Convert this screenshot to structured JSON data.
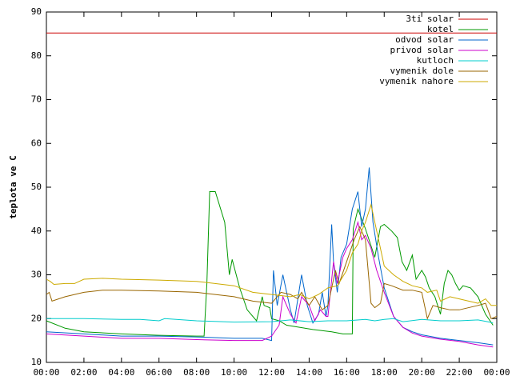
{
  "chart_data": {
    "type": "line",
    "title": "",
    "xlabel": "",
    "ylabel": "teplota ve C",
    "xlim": [
      "00:00",
      "24:00"
    ],
    "ylim": [
      10,
      90
    ],
    "grid": false,
    "legend_position": "top-right",
    "x_ticks": [
      "00:00",
      "02:00",
      "04:00",
      "06:00",
      "08:00",
      "10:00",
      "12:00",
      "14:00",
      "16:00",
      "18:00",
      "20:00",
      "22:00",
      "00:00"
    ],
    "y_ticks": [
      10,
      20,
      30,
      40,
      50,
      60,
      70,
      80,
      90
    ],
    "series": [
      {
        "name": "3ti solar",
        "color": "#cc0000",
        "x": [
          0,
          24
        ],
        "y": [
          85.2,
          85.2
        ]
      },
      {
        "name": "kotel",
        "color": "#009900",
        "x": [
          0,
          1,
          2,
          4,
          6,
          8,
          8.4,
          8.55,
          8.7,
          9,
          9.5,
          9.75,
          9.9,
          10.3,
          10.7,
          11.2,
          11.5,
          11.6,
          11.9,
          12.0,
          12.4,
          12.8,
          14.2,
          15.2,
          15.8,
          16.3,
          16.35,
          16.6,
          17.0,
          17.5,
          17.8,
          18.0,
          18.4,
          18.7,
          18.95,
          19.2,
          19.5,
          19.7,
          20.0,
          20.2,
          20.4,
          20.7,
          21.0,
          21.2,
          21.4,
          21.6,
          21.8,
          22.0,
          22.2,
          22.6,
          23.0,
          23.4,
          23.8
        ],
        "y": [
          19.5,
          17.8,
          17,
          16.5,
          16.2,
          16,
          16,
          28,
          49,
          49,
          42,
          30,
          33.5,
          27,
          22,
          19.5,
          25,
          23,
          22.5,
          20,
          19.5,
          18.5,
          17.5,
          17,
          16.5,
          16.5,
          40.5,
          45,
          40.5,
          34,
          41,
          41.5,
          40,
          38.5,
          33,
          31,
          34.5,
          29,
          31,
          29.5,
          27,
          25,
          21,
          28,
          31,
          30,
          28,
          26.5,
          27.5,
          27,
          25,
          21,
          18.5
        ]
      },
      {
        "name": "odvod solar",
        "color": "#0066cc",
        "x": [
          0,
          2,
          4,
          6,
          8,
          10,
          11.5,
          12.0,
          12.1,
          12.3,
          12.6,
          13.0,
          13.2,
          13.6,
          13.9,
          14.2,
          14.5,
          14.7,
          14.9,
          15.0,
          15.2,
          15.3,
          15.5,
          15.7,
          16.0,
          16.3,
          16.6,
          16.8,
          17.0,
          17.2,
          17.4,
          17.7,
          18.0,
          18.5,
          19.0,
          19.5,
          20,
          21,
          22,
          23,
          23.8
        ],
        "y": [
          17,
          16.5,
          16,
          16,
          15.8,
          15.5,
          15.5,
          15,
          31,
          23,
          30,
          22,
          19,
          30,
          23,
          19,
          21,
          26,
          20.5,
          23,
          41.5,
          33,
          26,
          34,
          37,
          45,
          49,
          41,
          45,
          54.5,
          42,
          34,
          27,
          20.5,
          18,
          17,
          16.3,
          15.5,
          15,
          14.5,
          14
        ]
      },
      {
        "name": "privod solar",
        "color": "#cc00cc",
        "x": [
          0,
          2,
          4,
          6,
          8,
          10,
          11.5,
          12.0,
          12.4,
          12.6,
          13.0,
          13.3,
          13.6,
          14.0,
          14.3,
          14.6,
          14.9,
          15.0,
          15.3,
          15.5,
          15.8,
          16.0,
          16.3,
          16.6,
          16.8,
          17.0,
          17.3,
          17.6,
          18.0,
          18.5,
          19.0,
          19.5,
          20,
          21,
          22,
          23,
          23.8
        ],
        "y": [
          16.5,
          16,
          15.5,
          15.5,
          15.2,
          15,
          15,
          16,
          18.5,
          25,
          21,
          19,
          25,
          23,
          19.5,
          22,
          20.5,
          20.5,
          33,
          28,
          34,
          36,
          38,
          42,
          38,
          39,
          36,
          31,
          26,
          20.5,
          18,
          16.7,
          16,
          15.3,
          14.8,
          14,
          13.5
        ]
      },
      {
        "name": "kutloch",
        "color": "#00cccc",
        "x": [
          0,
          2,
          4,
          5,
          6,
          6.3,
          8,
          10,
          12,
          13,
          14,
          15,
          16,
          17,
          17.5,
          18,
          18.5,
          19,
          20,
          21,
          22,
          23,
          23.5,
          23.8
        ],
        "y": [
          20,
          20,
          19.8,
          19.8,
          19.5,
          20,
          19.5,
          19.2,
          19.3,
          19.7,
          19.3,
          19.5,
          19.5,
          19.8,
          19.5,
          19.8,
          20,
          19.3,
          19.8,
          19.5,
          19.5,
          19.7,
          19.3,
          19
        ]
      },
      {
        "name": "vymenik dole",
        "color": "#996600",
        "x": [
          0,
          0.15,
          0.3,
          1,
          2,
          3,
          4,
          6,
          8,
          10,
          11,
          12,
          12.5,
          13,
          13.4,
          13.6,
          14.0,
          14.3,
          14.7,
          15.0,
          15.4,
          15.6,
          16.0,
          16.4,
          16.7,
          17.0,
          17.3,
          17.5,
          17.8,
          18.0,
          18.4,
          19.0,
          19.5,
          20.0,
          20.3,
          20.6,
          21.0,
          21.5,
          22,
          23,
          23.4,
          23.7,
          24
        ],
        "y": [
          25.5,
          26,
          24,
          25,
          26,
          26.5,
          26.5,
          26.3,
          26,
          25,
          24,
          23.5,
          26,
          25.5,
          24.5,
          26,
          23,
          25,
          22,
          23,
          31,
          28,
          33,
          38,
          41,
          38,
          23.5,
          22.5,
          23.5,
          28,
          27.5,
          26.5,
          26.5,
          26,
          20,
          23,
          22.5,
          22,
          22,
          23,
          23.5,
          20,
          20.5
        ]
      },
      {
        "name": "vymenik nahore",
        "color": "#ccaa00",
        "x": [
          0,
          0.2,
          0.4,
          1,
          1.5,
          2,
          3,
          4,
          6,
          8,
          10,
          11,
          12,
          13,
          13.5,
          14.0,
          14.5,
          15.0,
          15.5,
          16.0,
          16.3,
          16.6,
          16.8,
          17.0,
          17.3,
          17.6,
          18.0,
          18.5,
          19.0,
          19.5,
          20.0,
          20.3,
          20.8,
          21.0,
          21.5,
          22.0,
          22.5,
          23.0,
          23.4,
          23.7,
          24
        ],
        "y": [
          29,
          28.5,
          27.8,
          28,
          28,
          29,
          29.2,
          29,
          28.8,
          28.5,
          27.5,
          26,
          25.5,
          25,
          25.5,
          24.5,
          25.5,
          27,
          27.5,
          31,
          35,
          37,
          40,
          42,
          46,
          40,
          32,
          30,
          28.5,
          27.5,
          27,
          26,
          26.5,
          24,
          25,
          24.5,
          24,
          23.5,
          24.5,
          23,
          23
        ]
      }
    ]
  }
}
